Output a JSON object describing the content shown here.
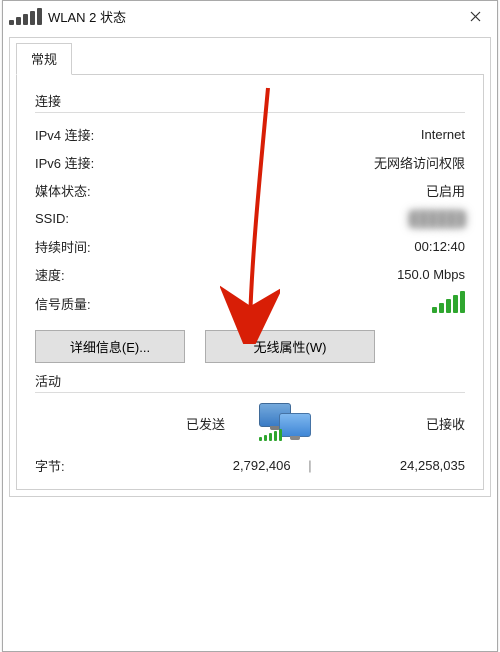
{
  "window": {
    "title": "WLAN 2 状态"
  },
  "tabs": {
    "general": "常规"
  },
  "connection": {
    "heading": "连接",
    "ipv4_label": "IPv4 连接:",
    "ipv4_value": "Internet",
    "ipv6_label": "IPv6 连接:",
    "ipv6_value": "无网络访问权限",
    "media_label": "媒体状态:",
    "media_value": "已启用",
    "ssid_label": "SSID:",
    "ssid_value": "██████",
    "duration_label": "持续时间:",
    "duration_value": "00:12:40",
    "speed_label": "速度:",
    "speed_value": "150.0 Mbps",
    "signal_label": "信号质量:"
  },
  "buttons": {
    "details": "详细信息(E)...",
    "wireless_props": "无线属性(W)"
  },
  "activity": {
    "heading": "活动",
    "sent": "已发送",
    "received": "已接收",
    "bytes_label": "字节:",
    "bytes_sent": "2,792,406",
    "bytes_received": "24,258,035"
  },
  "colors": {
    "signal_green": "#2fa62f",
    "accent_blue": "#0078d7",
    "arrow_red": "#d81e06"
  }
}
